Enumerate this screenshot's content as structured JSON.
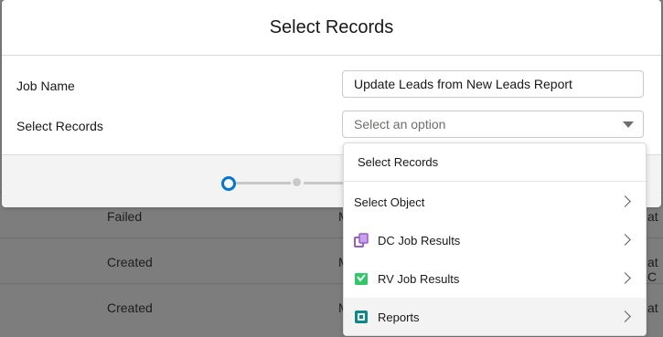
{
  "modal": {
    "title": "Select Records",
    "fields": {
      "job_name_label": "Job Name",
      "job_name_value": "Update Leads from New Leads Report",
      "select_records_label": "Select Records",
      "select_records_placeholder": "Select an option"
    }
  },
  "dropdown": {
    "header": "Select Records",
    "items": [
      {
        "label": "Select Object",
        "icon": "none"
      },
      {
        "label": "DC Job Results",
        "icon": "dc-job-results-icon",
        "color": "#9b59d0"
      },
      {
        "label": "RV Job Results",
        "icon": "rv-job-results-icon",
        "color": "#2ec866"
      },
      {
        "label": "Reports",
        "icon": "reports-icon",
        "color": "#0b8a8a"
      }
    ]
  },
  "background_rows": [
    {
      "status": "Failed",
      "col2": "M",
      "col3": "at"
    },
    {
      "status": "Created",
      "col2": "M",
      "col3": "at C"
    },
    {
      "status": "Created",
      "col2": "M",
      "col3": "at"
    }
  ]
}
